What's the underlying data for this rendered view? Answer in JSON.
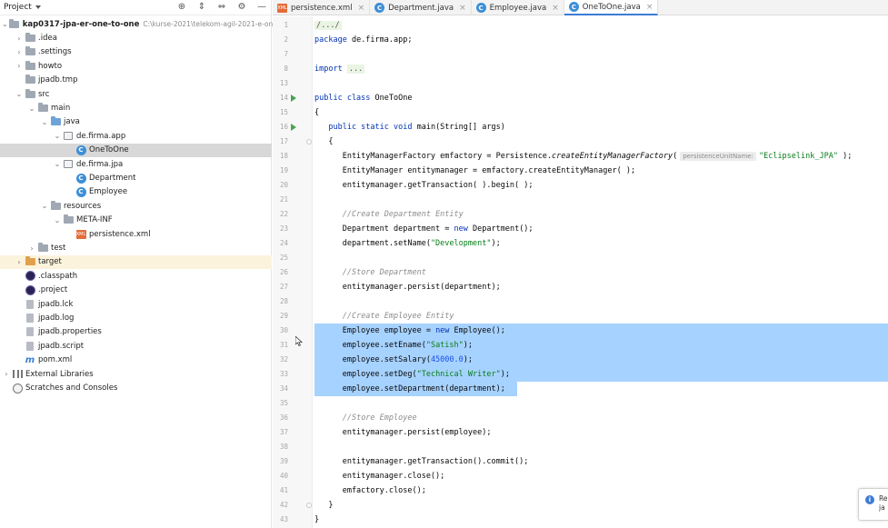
{
  "project_panel": {
    "title": "Project",
    "tools": {
      "locate": "⊕",
      "collapse": "⇕",
      "expand": "⇔",
      "settings": "⚙",
      "hide": "—"
    },
    "tree": [
      {
        "label": "kap0317-jpa-er-one-to-one",
        "path": "C:\\kurse-2021\\telekom-agil-2021-e-online\\re",
        "icon": "module-folder-icon",
        "depth": 0,
        "arrow": "open",
        "bold": true
      },
      {
        "label": ".idea",
        "icon": "folder-icon",
        "depth": 1,
        "arrow": "closed"
      },
      {
        "label": ".settings",
        "icon": "folder-icon",
        "depth": 1,
        "arrow": "closed"
      },
      {
        "label": "howto",
        "icon": "folder-icon",
        "depth": 1,
        "arrow": "closed"
      },
      {
        "label": "jpadb.tmp",
        "icon": "folder-icon",
        "depth": 1,
        "arrow": "none"
      },
      {
        "label": "src",
        "icon": "folder-icon",
        "depth": 1,
        "arrow": "open"
      },
      {
        "label": "main",
        "icon": "folder-icon",
        "depth": 2,
        "arrow": "open"
      },
      {
        "label": "java",
        "icon": "source-folder-icon",
        "depth": 3,
        "arrow": "open"
      },
      {
        "label": "de.firma.app",
        "icon": "package-icon",
        "depth": 4,
        "arrow": "open"
      },
      {
        "label": "OneToOne",
        "icon": "class-icon",
        "depth": 5,
        "arrow": "none",
        "selected": true
      },
      {
        "label": "de.firma.jpa",
        "icon": "package-icon",
        "depth": 4,
        "arrow": "open"
      },
      {
        "label": "Department",
        "icon": "entity-class-icon",
        "depth": 5,
        "arrow": "none"
      },
      {
        "label": "Employee",
        "icon": "entity-class-icon",
        "depth": 5,
        "arrow": "none"
      },
      {
        "label": "resources",
        "icon": "resources-folder-icon",
        "depth": 3,
        "arrow": "open"
      },
      {
        "label": "META-INF",
        "icon": "folder-icon",
        "depth": 4,
        "arrow": "open"
      },
      {
        "label": "persistence.xml",
        "icon": "xml-file-icon",
        "depth": 5,
        "arrow": "none"
      },
      {
        "label": "test",
        "icon": "folder-icon",
        "depth": 2,
        "arrow": "closed"
      },
      {
        "label": "target",
        "icon": "excluded-folder-icon",
        "depth": 1,
        "arrow": "closed",
        "highlight": true
      },
      {
        "label": ".classpath",
        "icon": "eclipse-file-icon",
        "depth": 1,
        "arrow": "none"
      },
      {
        "label": ".project",
        "icon": "eclipse-file-icon",
        "depth": 1,
        "arrow": "none"
      },
      {
        "label": "jpadb.lck",
        "icon": "file-icon",
        "depth": 1,
        "arrow": "none"
      },
      {
        "label": "jpadb.log",
        "icon": "file-icon",
        "depth": 1,
        "arrow": "none"
      },
      {
        "label": "jpadb.properties",
        "icon": "file-icon",
        "depth": 1,
        "arrow": "none"
      },
      {
        "label": "jpadb.script",
        "icon": "file-icon",
        "depth": 1,
        "arrow": "none"
      },
      {
        "label": "pom.xml",
        "icon": "maven-icon",
        "depth": 1,
        "arrow": "none"
      },
      {
        "label": "External Libraries",
        "icon": "libraries-icon",
        "depth": 0,
        "arrow": "closed"
      },
      {
        "label": "Scratches and Consoles",
        "icon": "scratches-icon",
        "depth": 0,
        "arrow": "none"
      }
    ]
  },
  "tabs": [
    {
      "label": "persistence.xml",
      "icon": "xml-file-icon",
      "active": false
    },
    {
      "label": "Department.java",
      "icon": "class-icon",
      "active": false
    },
    {
      "label": "Employee.java",
      "icon": "class-icon",
      "active": false
    },
    {
      "label": "OneToOne.java",
      "icon": "class-icon",
      "active": true
    }
  ],
  "editor": {
    "line_numbers": [
      "1",
      "2",
      "7",
      "8",
      "13",
      "14",
      "15",
      "16",
      "17",
      "18",
      "19",
      "20",
      "21",
      "22",
      "23",
      "24",
      "25",
      "26",
      "27",
      "28",
      "29",
      "30",
      "31",
      "32",
      "33",
      "34",
      "35",
      "36",
      "37",
      "38",
      "39",
      "40",
      "41",
      "42",
      "43"
    ],
    "run_markers": [
      "14",
      "16"
    ],
    "lines": [
      [
        {
          "t": "/.../",
          "c": "fq"
        }
      ],
      [
        {
          "t": "package ",
          "c": "kw"
        },
        {
          "t": "de.firma.app;"
        }
      ],
      [],
      [
        {
          "t": "import ",
          "c": "kw"
        },
        {
          "t": "...",
          "c": "fq"
        }
      ],
      [],
      [
        {
          "t": "public class ",
          "c": "kw"
        },
        {
          "t": "OneToOne"
        }
      ],
      [
        {
          "t": "{"
        }
      ],
      [
        {
          "t": "   "
        },
        {
          "t": "public static void ",
          "c": "kw"
        },
        {
          "t": "main(String[] args)"
        }
      ],
      [
        {
          "t": "   {"
        }
      ],
      [
        {
          "t": "      EntityManagerFactory emfactory = Persistence."
        },
        {
          "t": "createEntityManagerFactory",
          "c": "it"
        },
        {
          "t": "("
        },
        {
          "t": "persistenceUnitName:",
          "c": "hint"
        },
        {
          "t": "\"Eclipselink_JPA\"",
          "c": "st"
        },
        {
          "t": " );"
        }
      ],
      [
        {
          "t": "      EntityManager entitymanager = emfactory.createEntityManager( );"
        }
      ],
      [
        {
          "t": "      entitymanager.getTransaction( ).begin( );"
        }
      ],
      [],
      [
        {
          "t": "      "
        },
        {
          "t": "//Create Department Entity",
          "c": "cm"
        }
      ],
      [
        {
          "t": "      Department department = "
        },
        {
          "t": "new ",
          "c": "kw"
        },
        {
          "t": "Department();"
        }
      ],
      [
        {
          "t": "      department.setName("
        },
        {
          "t": "\"Development\"",
          "c": "st"
        },
        {
          "t": ");"
        }
      ],
      [],
      [
        {
          "t": "      "
        },
        {
          "t": "//Store Department",
          "c": "cm"
        }
      ],
      [
        {
          "t": "      entitymanager.persist(department);"
        }
      ],
      [],
      [
        {
          "t": "      "
        },
        {
          "t": "//Create Employee Entity",
          "c": "cm"
        }
      ],
      [
        {
          "t": "      Employee employee = "
        },
        {
          "t": "new ",
          "c": "kw"
        },
        {
          "t": "Employee();"
        }
      ],
      [
        {
          "t": "      employee.setEname("
        },
        {
          "t": "\"Satish\"",
          "c": "st"
        },
        {
          "t": ");"
        }
      ],
      [
        {
          "t": "      employee.setSalary("
        },
        {
          "t": "45000.0",
          "c": "nm"
        },
        {
          "t": ");"
        }
      ],
      [
        {
          "t": "      employee.setDeg("
        },
        {
          "t": "\"Technical Writer\"",
          "c": "st"
        },
        {
          "t": ");"
        }
      ],
      [
        {
          "t": "      employee.setDepartment(department);"
        }
      ],
      [],
      [
        {
          "t": "      "
        },
        {
          "t": "//Store Employee",
          "c": "cm"
        }
      ],
      [
        {
          "t": "      entitymanager.persist(employee);"
        }
      ],
      [],
      [
        {
          "t": "      entitymanager.getTransaction().commit();"
        }
      ],
      [
        {
          "t": "      entitymanager.close();"
        }
      ],
      [
        {
          "t": "      emfactory.close();"
        }
      ],
      [
        {
          "t": "   }"
        }
      ],
      [
        {
          "t": "}"
        }
      ]
    ],
    "selected_lines": [
      "30",
      "31",
      "32",
      "33",
      "34"
    ]
  },
  "notification": {
    "icon": "info-icon",
    "text_line1": "Re",
    "text_line2": "ja"
  }
}
